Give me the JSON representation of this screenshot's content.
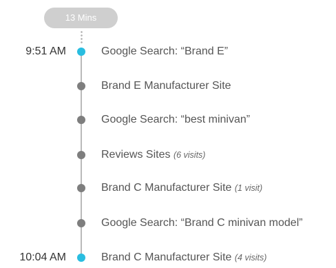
{
  "header": {
    "duration_label": "13 Mins"
  },
  "colors": {
    "accent": "#29bde0",
    "node": "#7e7e7e",
    "line": "#b9b9b9",
    "pill": "#cfcfcf"
  },
  "timeline": [
    {
      "time": "9:51 AM",
      "label": "Google Search: “Brand E”",
      "note": ""
    },
    {
      "time": "",
      "label": "Brand E Manufacturer Site",
      "note": ""
    },
    {
      "time": "",
      "label": "Google Search: “best minivan”",
      "note": ""
    },
    {
      "time": "",
      "label": "Reviews Sites",
      "note": "(6 visits)"
    },
    {
      "time": "",
      "label": "Brand C Manufacturer Site",
      "note": "(1 visit)"
    },
    {
      "time": "",
      "label": "Google Search: “Brand C minivan model”",
      "note": ""
    },
    {
      "time": "10:04 AM",
      "label": "Brand C Manufacturer Site",
      "note": "(4 visits)"
    }
  ]
}
